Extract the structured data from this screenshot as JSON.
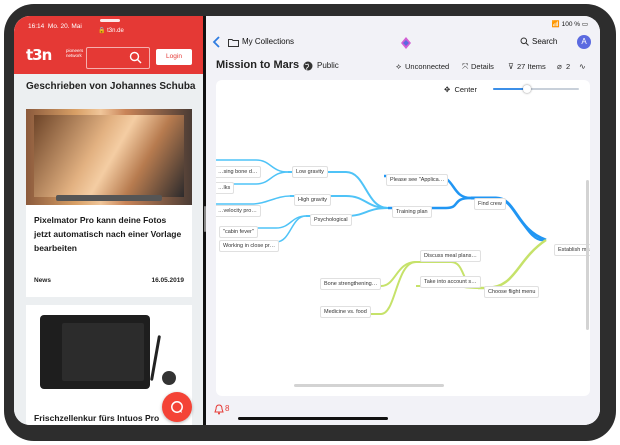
{
  "left_app": {
    "status_time": "16:14",
    "status_date": "Mo. 20. Mai",
    "url": "t3n.de",
    "logo": "t3n",
    "logo_tagline": "pioneers network",
    "login_label": "Login",
    "section_title": "Geschrieben von Johannes Schuba",
    "articles": [
      {
        "title": "Pixelmator Pro kann deine Fotos jetzt automatisch nach einer Vorlage bearbeiten",
        "category": "News",
        "date": "16.05.2019"
      },
      {
        "title": "Frischzellenkur fürs Intuos Pro"
      }
    ]
  },
  "right_app": {
    "status_battery": "100 %",
    "nav": {
      "collections": "My Collections",
      "search": "Search",
      "avatar": "A"
    },
    "toolbar": {
      "title": "Mission to Mars",
      "visibility": "Public",
      "unconnected": "Unconnected",
      "details": "Details",
      "items": "27 Items",
      "attachments": "2"
    },
    "center_label": "Center",
    "zoom_level": 0.4,
    "notifications": "8",
    "colors": {
      "accent": "#3c8fe8",
      "blue_branch": "#2196f3",
      "cyan_branch": "#4fc3f7",
      "green_branch": "#c6e26a"
    },
    "mindmap": {
      "root": "Establish mars",
      "nodes": {
        "low_gravity": "Low gravity",
        "high_gravity": "High gravity",
        "psychological": "Psychological",
        "bone": "…sing bone d…",
        "ilks": "…lks",
        "velocity": "…velocity pro…",
        "cabin_fever": "\"cabin fever\"",
        "working_close": "Working in close pr…",
        "please_see": "Please see \"Applica…",
        "training_plan": "Training plan",
        "find_crew": "Find crew",
        "discuss_meal": "Discuss meal plans…",
        "take_into_account": "Take into account s…",
        "bone_strengthening": "Bone strengthening…",
        "medicine_food": "Medicine vs. food",
        "choose_flight": "Choose flight menu"
      }
    }
  }
}
